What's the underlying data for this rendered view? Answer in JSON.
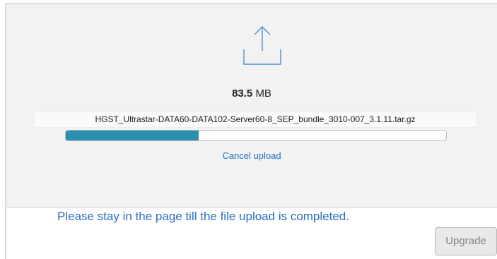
{
  "upload": {
    "size_value": "83.5",
    "size_unit": "MB",
    "filename": "HGST_Ultrastar-DATA60-DATA102-Server60-8_SEP_bundle_3010-007_3.1.11.tar.gz",
    "progress_fraction": 0.35,
    "cancel_label": "Cancel upload",
    "icon": "upload-icon"
  },
  "notice": {
    "text": "Please stay in the page till the file upload is completed."
  },
  "actions": {
    "upgrade_label": "Upgrade"
  },
  "colors": {
    "progress_fill": "#2a8fb0",
    "link": "#1c6fc0",
    "icon_stroke": "#4a90d9"
  }
}
